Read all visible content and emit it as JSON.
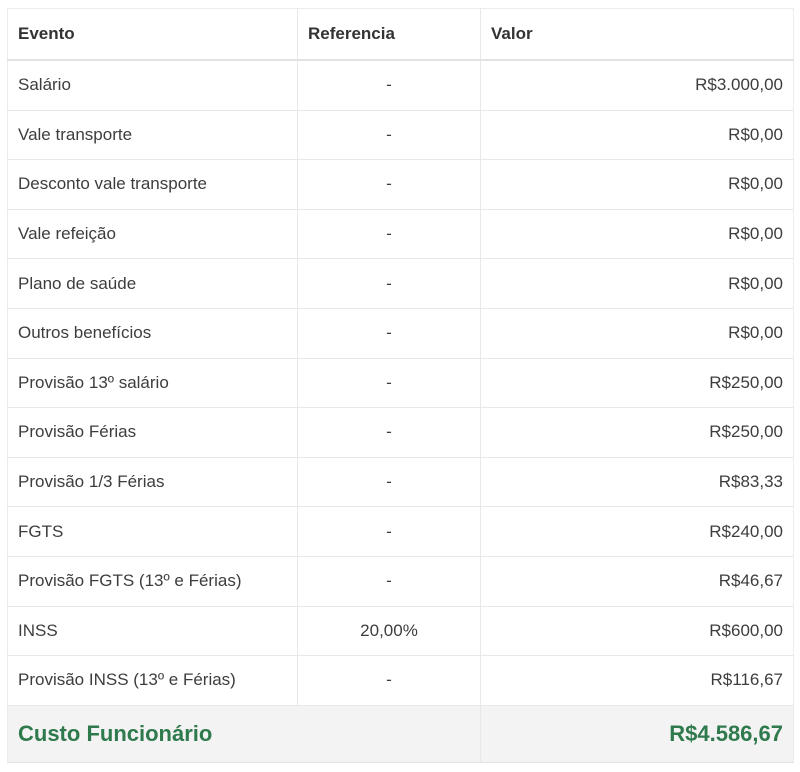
{
  "table": {
    "headers": {
      "evento": "Evento",
      "referencia": "Referencia",
      "valor": "Valor"
    },
    "rows": [
      {
        "evento": "Salário",
        "referencia": "-",
        "valor": "R$3.000,00"
      },
      {
        "evento": "Vale transporte",
        "referencia": "-",
        "valor": "R$0,00"
      },
      {
        "evento": "Desconto vale transporte",
        "referencia": "-",
        "valor": "R$0,00"
      },
      {
        "evento": "Vale refeição",
        "referencia": "-",
        "valor": "R$0,00"
      },
      {
        "evento": "Plano de saúde",
        "referencia": "-",
        "valor": "R$0,00"
      },
      {
        "evento": "Outros benefícios",
        "referencia": "-",
        "valor": "R$0,00"
      },
      {
        "evento": "Provisão 13º salário",
        "referencia": "-",
        "valor": "R$250,00"
      },
      {
        "evento": "Provisão Férias",
        "referencia": "-",
        "valor": "R$250,00"
      },
      {
        "evento": "Provisão 1/3 Férias",
        "referencia": "-",
        "valor": "R$83,33"
      },
      {
        "evento": "FGTS",
        "referencia": "-",
        "valor": "R$240,00"
      },
      {
        "evento": "Provisão FGTS (13º e Férias)",
        "referencia": "-",
        "valor": "R$46,67"
      },
      {
        "evento": "INSS",
        "referencia": "20,00%",
        "valor": "R$600,00"
      },
      {
        "evento": "Provisão INSS (13º e Férias)",
        "referencia": "-",
        "valor": "R$116,67"
      }
    ],
    "footer": {
      "label": "Custo Funcionário",
      "value": "R$4.586,67"
    }
  },
  "colors": {
    "total_text": "#2f7a4d",
    "footer_bg": "#f2f3f2",
    "border": "#e8e8e8"
  }
}
